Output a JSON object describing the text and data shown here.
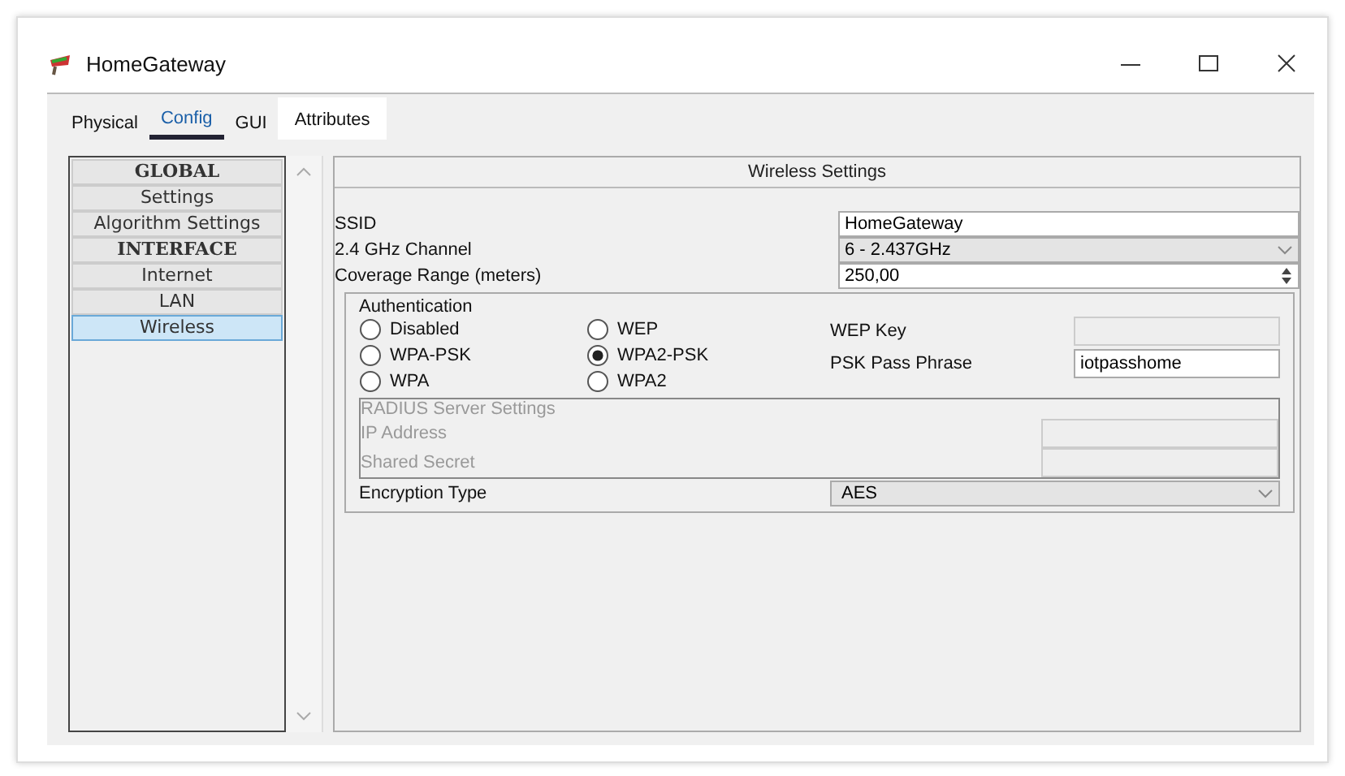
{
  "window": {
    "title": "HomeGateway"
  },
  "tabs": [
    {
      "label": "Physical",
      "selected": false
    },
    {
      "label": "Config",
      "selected": true
    },
    {
      "label": "GUI",
      "selected": false
    },
    {
      "label": "Attributes",
      "selected": false
    }
  ],
  "sidebar": {
    "items": [
      {
        "label": "GLOBAL",
        "kind": "heading",
        "selected": false
      },
      {
        "label": "Settings",
        "kind": "item",
        "selected": false
      },
      {
        "label": "Algorithm Settings",
        "kind": "item",
        "selected": false
      },
      {
        "label": "INTERFACE",
        "kind": "heading",
        "selected": false
      },
      {
        "label": "Internet",
        "kind": "item",
        "selected": false
      },
      {
        "label": "LAN",
        "kind": "item",
        "selected": false
      },
      {
        "label": "Wireless",
        "kind": "item",
        "selected": true
      }
    ]
  },
  "panel": {
    "title": "Wireless Settings",
    "fields": [
      {
        "label": "SSID",
        "kind": "text",
        "value": "HomeGateway"
      },
      {
        "label": "2.4 GHz Channel",
        "kind": "select",
        "value": "6 - 2.437GHz"
      },
      {
        "label": "Coverage Range (meters)",
        "kind": "spin",
        "value": "250,00"
      }
    ],
    "authentication": {
      "title": "Authentication",
      "options": [
        {
          "label": "Disabled",
          "selected": false
        },
        {
          "label": "WEP",
          "selected": false
        },
        {
          "label": "WPA-PSK",
          "selected": false
        },
        {
          "label": "WPA2-PSK",
          "selected": true
        },
        {
          "label": "WPA",
          "selected": false
        },
        {
          "label": "WPA2",
          "selected": false
        }
      ],
      "wep_key": {
        "label": "WEP Key",
        "disabled": true
      },
      "psk_pass_phrase": {
        "label": "PSK Pass Phrase",
        "value": "iotpasshome",
        "disabled": false
      },
      "radius": {
        "title": "RADIUS Server Settings",
        "disabled": true,
        "fields": [
          {
            "label": "IP Address"
          },
          {
            "label": "Shared Secret"
          }
        ]
      },
      "encryption": {
        "label": "Encryption Type",
        "value": "AES"
      }
    }
  }
}
